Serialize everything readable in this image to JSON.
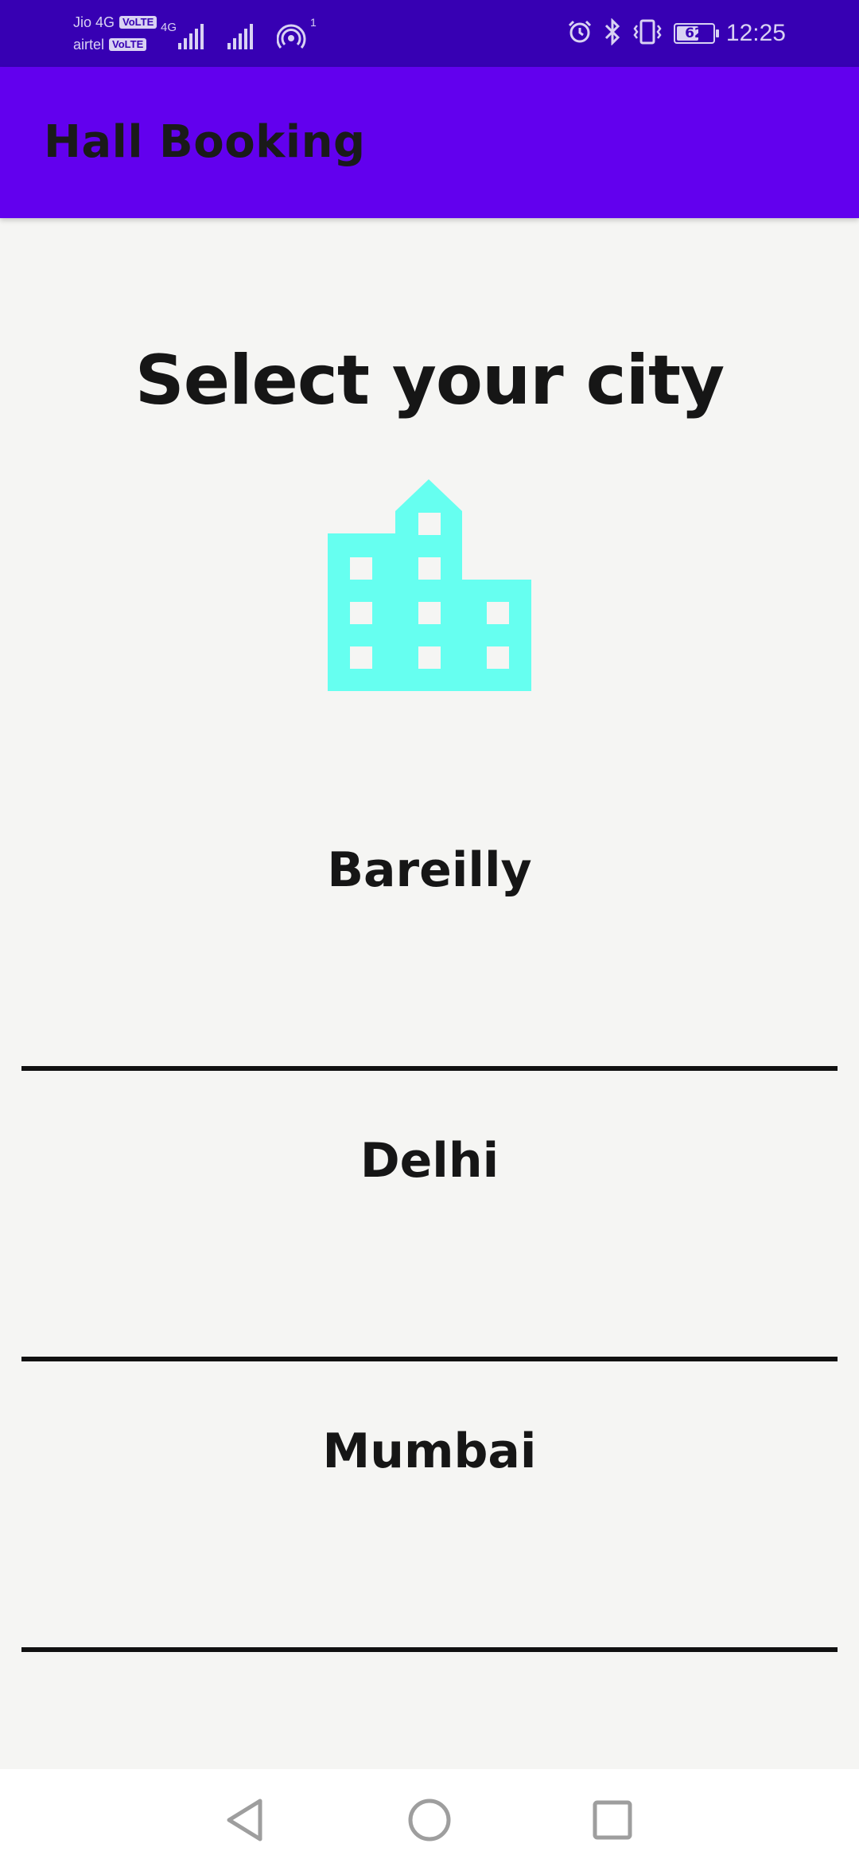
{
  "status_bar": {
    "carrier_1": "Jio 4G",
    "carrier_2": "airtel",
    "volte_label": "VoLTE",
    "network_type": "4G",
    "hotspot_count": "1",
    "battery_level": "62",
    "battery_fraction": 0.62,
    "time": "12:25",
    "icons": [
      "signal-icon",
      "signal-icon",
      "hotspot-icon",
      "alarm-icon",
      "bluetooth-icon",
      "vibrate-icon",
      "battery-icon"
    ]
  },
  "app_bar": {
    "title": "Hall Booking"
  },
  "main": {
    "heading": "Select your city",
    "icon": "city-building-icon",
    "cities": [
      {
        "label": "Bareilly"
      },
      {
        "label": "Delhi"
      },
      {
        "label": "Mumbai"
      }
    ]
  },
  "nav_bar": {
    "buttons": [
      "back-icon",
      "home-icon",
      "recents-icon"
    ]
  },
  "colors": {
    "status_bar": "#3700b3",
    "app_bar": "#6200ee",
    "background": "#f5f5f3",
    "icon": "#66fff0",
    "divider": "#111111"
  }
}
